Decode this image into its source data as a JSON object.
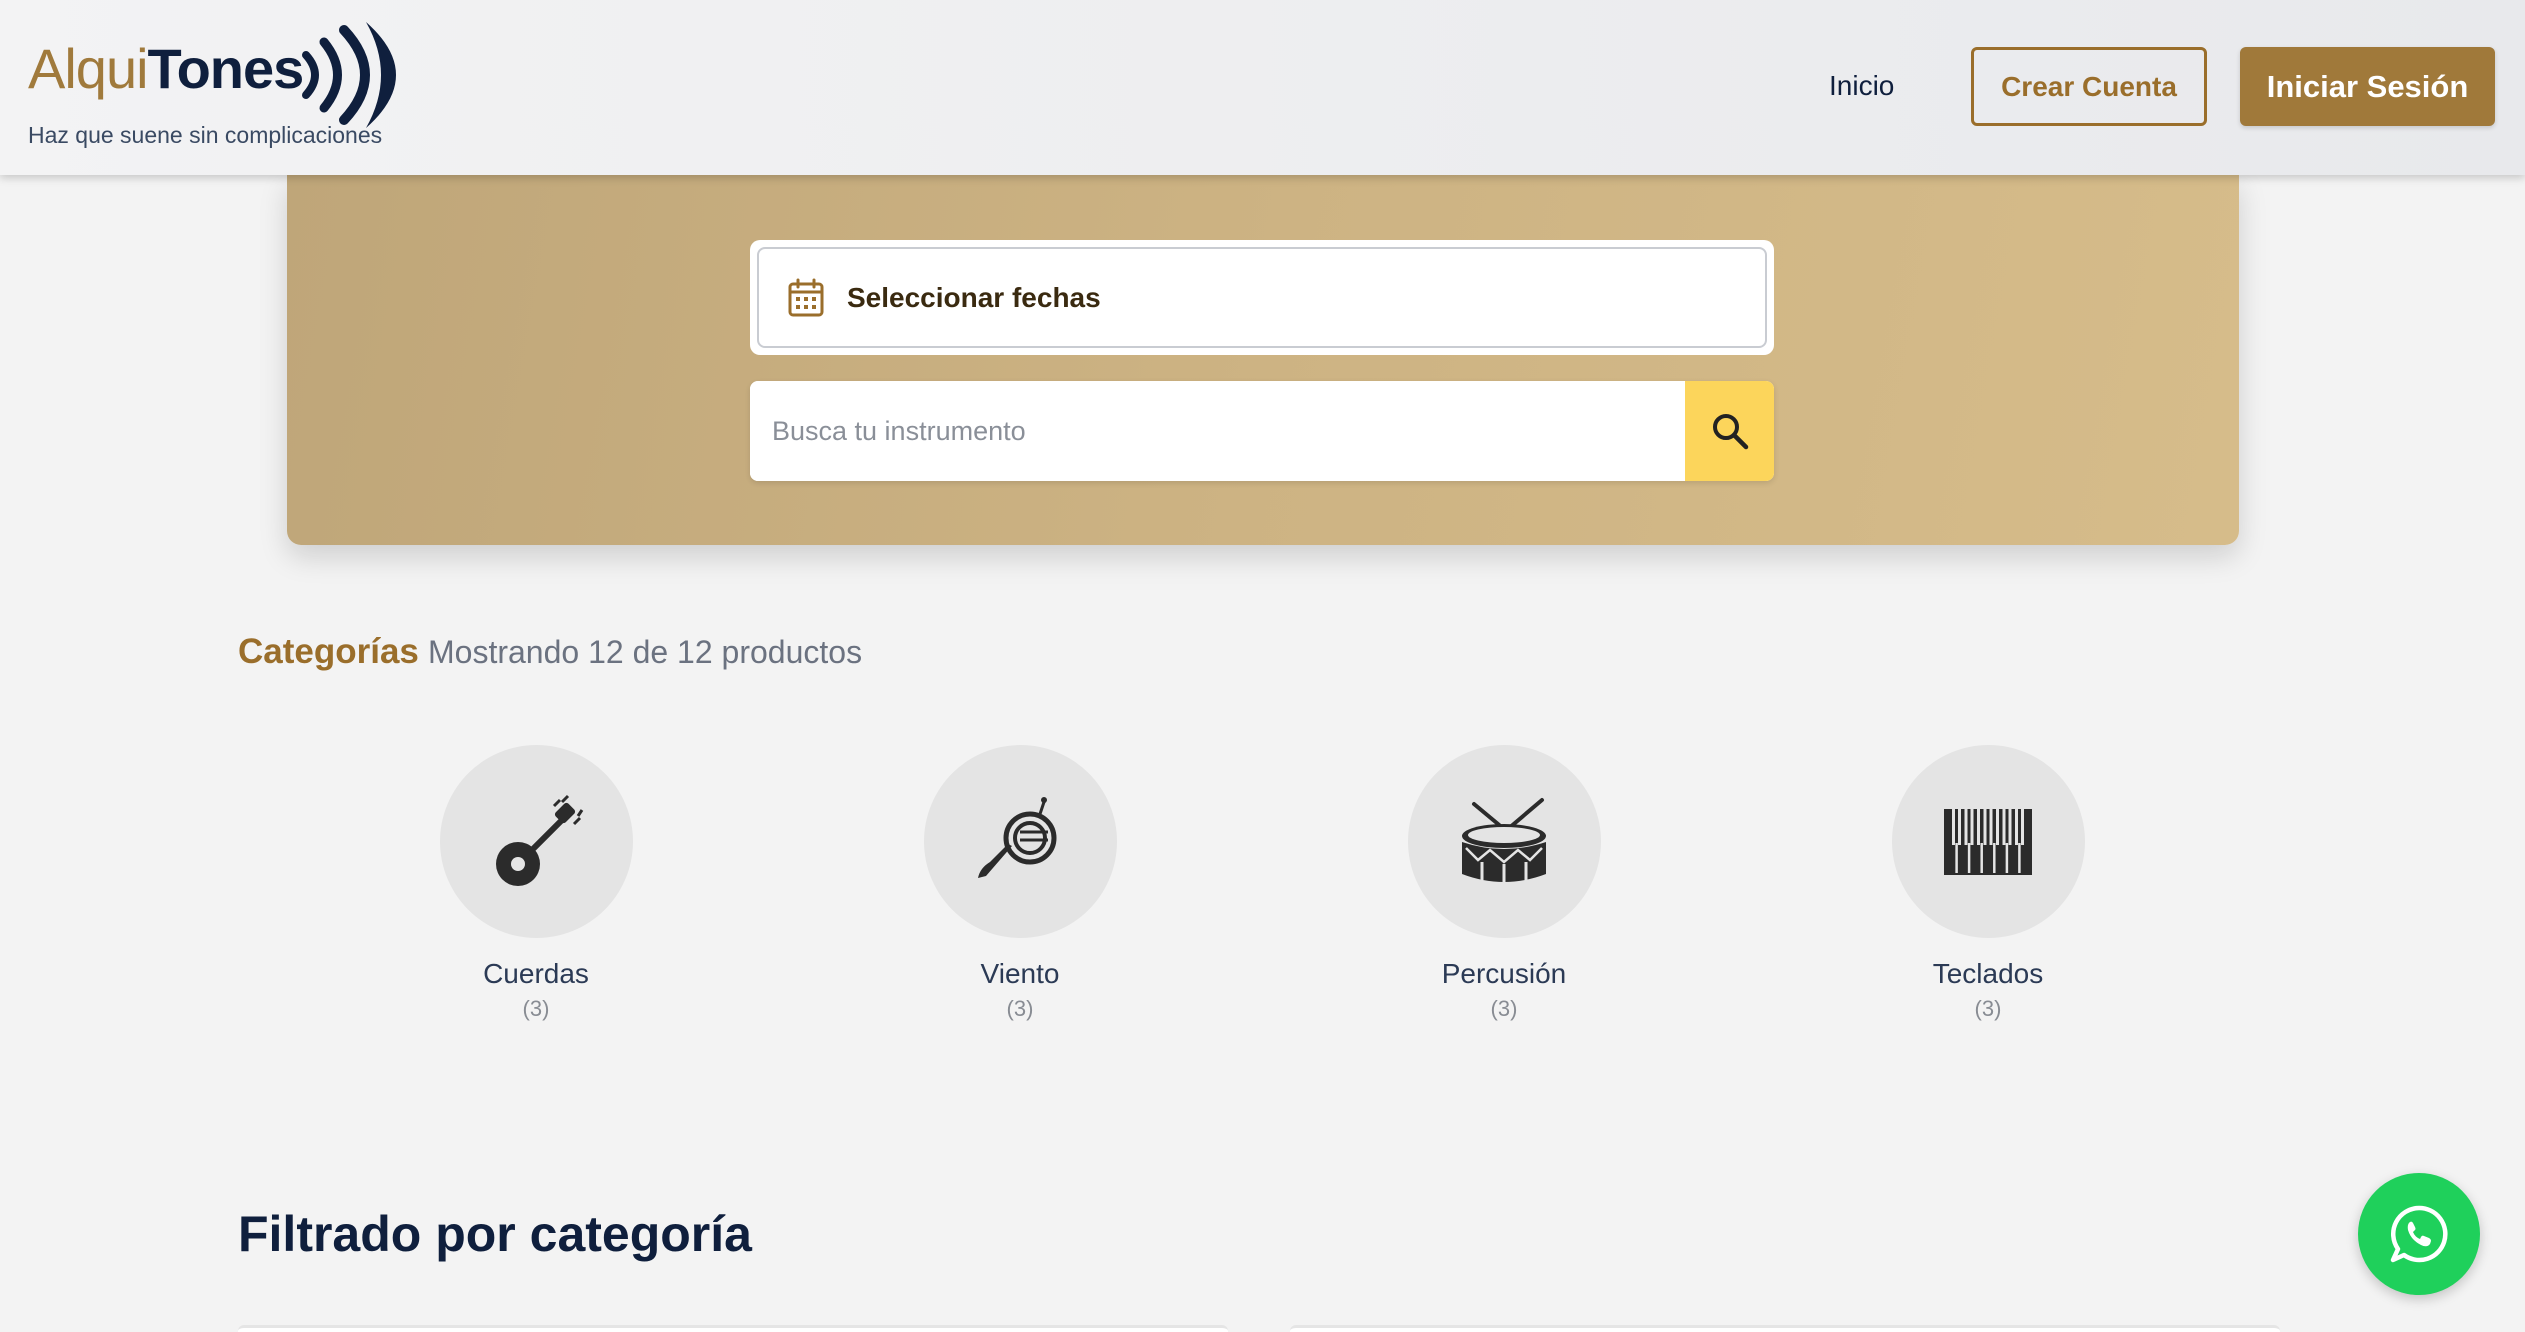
{
  "header": {
    "logo_light": "Alqui",
    "logo_bold": "Tones",
    "tagline": "Haz que suene sin complicaciones",
    "nav_inicio": "Inicio",
    "crear_cuenta": "Crear Cuenta",
    "iniciar_sesion": "Iniciar Sesión"
  },
  "search": {
    "date_label": "Seleccionar fechas",
    "placeholder": "Busca tu instrumento"
  },
  "categories": {
    "title": "Categorías",
    "subtitle": "Mostrando 12 de 12 productos",
    "items": [
      {
        "name": "Cuerdas",
        "count": "(3)",
        "icon": "banjo-icon"
      },
      {
        "name": "Viento",
        "count": "(3)",
        "icon": "french-horn-icon"
      },
      {
        "name": "Percusión",
        "count": "(3)",
        "icon": "drum-icon"
      },
      {
        "name": "Teclados",
        "count": "(3)",
        "icon": "piano-keys-icon"
      }
    ]
  },
  "filter": {
    "heading": "Filtrado por categoría"
  },
  "colors": {
    "brand_gold": "#a0793a",
    "navy": "#0f1f3d",
    "search_button": "#fcd55b",
    "whatsapp": "#1fd05b"
  }
}
